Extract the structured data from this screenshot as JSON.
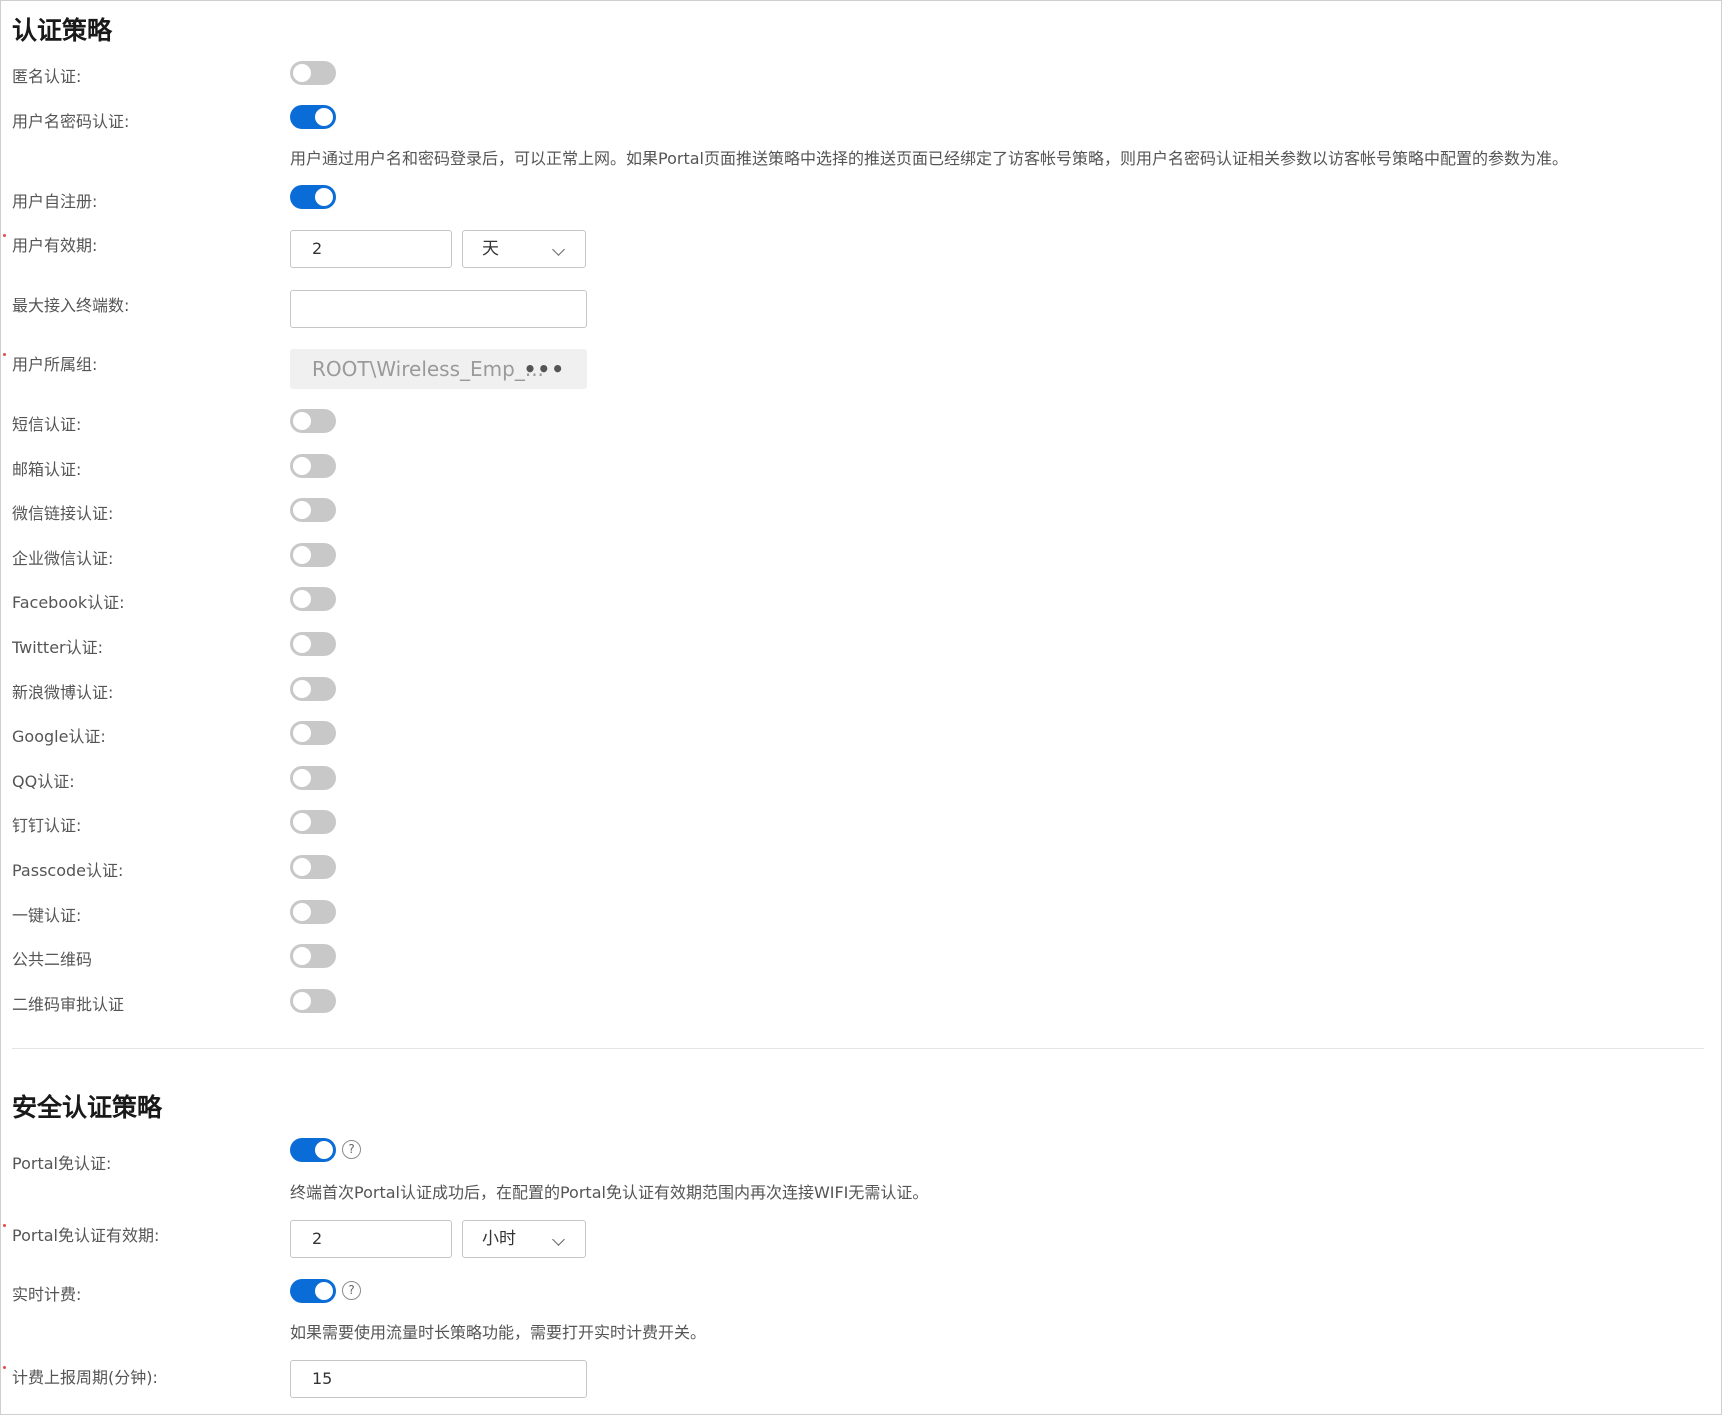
{
  "auth_policy": {
    "title": "认证策略",
    "anonymous": {
      "label": "匿名认证:",
      "enabled": false
    },
    "username_password": {
      "label": "用户名密码认证:",
      "enabled": true,
      "hint": "用户通过用户名和密码登录后，可以正常上网。如果Portal页面推送策略中选择的推送页面已经绑定了访客帐号策略，则用户名密码认证相关参数以访客帐号策略中配置的参数为准。"
    },
    "self_register": {
      "label": "用户自注册:",
      "enabled": true
    },
    "validity": {
      "label": "用户有效期:",
      "value": "2",
      "unit": "天"
    },
    "max_terminals": {
      "label": "最大接入终端数:",
      "value": ""
    },
    "user_group": {
      "label": "用户所属组:",
      "value": "ROOT\\Wireless_Emp_...",
      "more": "•••"
    },
    "methods": [
      {
        "label": "短信认证:",
        "enabled": false
      },
      {
        "label": "邮箱认证:",
        "enabled": false
      },
      {
        "label": "微信链接认证:",
        "enabled": false
      },
      {
        "label": "企业微信认证:",
        "enabled": false
      },
      {
        "label": "Facebook认证:",
        "enabled": false
      },
      {
        "label": "Twitter认证:",
        "enabled": false
      },
      {
        "label": "新浪微博认证:",
        "enabled": false
      },
      {
        "label": "Google认证:",
        "enabled": false
      },
      {
        "label": "QQ认证:",
        "enabled": false
      },
      {
        "label": "钉钉认证:",
        "enabled": false
      },
      {
        "label": "Passcode认证:",
        "enabled": false
      },
      {
        "label": "一键认证:",
        "enabled": false
      },
      {
        "label": "公共二维码",
        "enabled": false
      },
      {
        "label": "二维码审批认证",
        "enabled": false
      }
    ]
  },
  "security_policy": {
    "title": "安全认证策略",
    "portal_free": {
      "label": "Portal免认证:",
      "enabled": true,
      "help": "?",
      "hint": "终端首次Portal认证成功后，在配置的Portal免认证有效期范围内再次连接WIFI无需认证。"
    },
    "portal_free_validity": {
      "label": "Portal免认证有效期:",
      "value": "2",
      "unit": "小时"
    },
    "realtime_billing": {
      "label": "实时计费:",
      "enabled": true,
      "help": "?",
      "hint": "如果需要使用流量时长策略功能，需要打开实时计费开关。"
    },
    "billing_period": {
      "label": "计费上报周期(分钟):",
      "value": "15"
    }
  },
  "colors": {
    "toggle_on": "#0a6cd6",
    "toggle_off": "#c8c8c8",
    "required_marker": "#e84a4a"
  }
}
